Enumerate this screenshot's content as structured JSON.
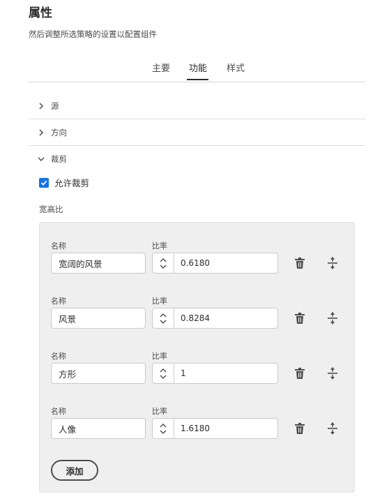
{
  "header": {
    "title": "属性",
    "subtitle": "然后调整所选策略的设置以配置组件"
  },
  "tabs": [
    {
      "label": "主要",
      "active": false
    },
    {
      "label": "功能",
      "active": true
    },
    {
      "label": "样式",
      "active": false
    }
  ],
  "accordion": [
    {
      "label": "源",
      "expanded": false,
      "icon": "chevron-right-icon"
    },
    {
      "label": "方向",
      "expanded": false,
      "icon": "chevron-right-icon"
    },
    {
      "label": "裁剪",
      "expanded": true,
      "icon": "chevron-down-icon"
    }
  ],
  "crop": {
    "allow_label": "允许裁剪",
    "allow_checked": true,
    "aspect_label": "宽高比",
    "name_label": "名称",
    "ratio_label": "比率",
    "rows": [
      {
        "name": "宽阔的风景",
        "ratio": "0.6180"
      },
      {
        "name": "风景",
        "ratio": "0.8284"
      },
      {
        "name": "方形",
        "ratio": "1"
      },
      {
        "name": "人像",
        "ratio": "1.6180"
      }
    ],
    "add_label": "添加"
  },
  "colors": {
    "accent": "#1473e6",
    "text": "#2c2c2c",
    "panel_bg": "#efefef"
  }
}
